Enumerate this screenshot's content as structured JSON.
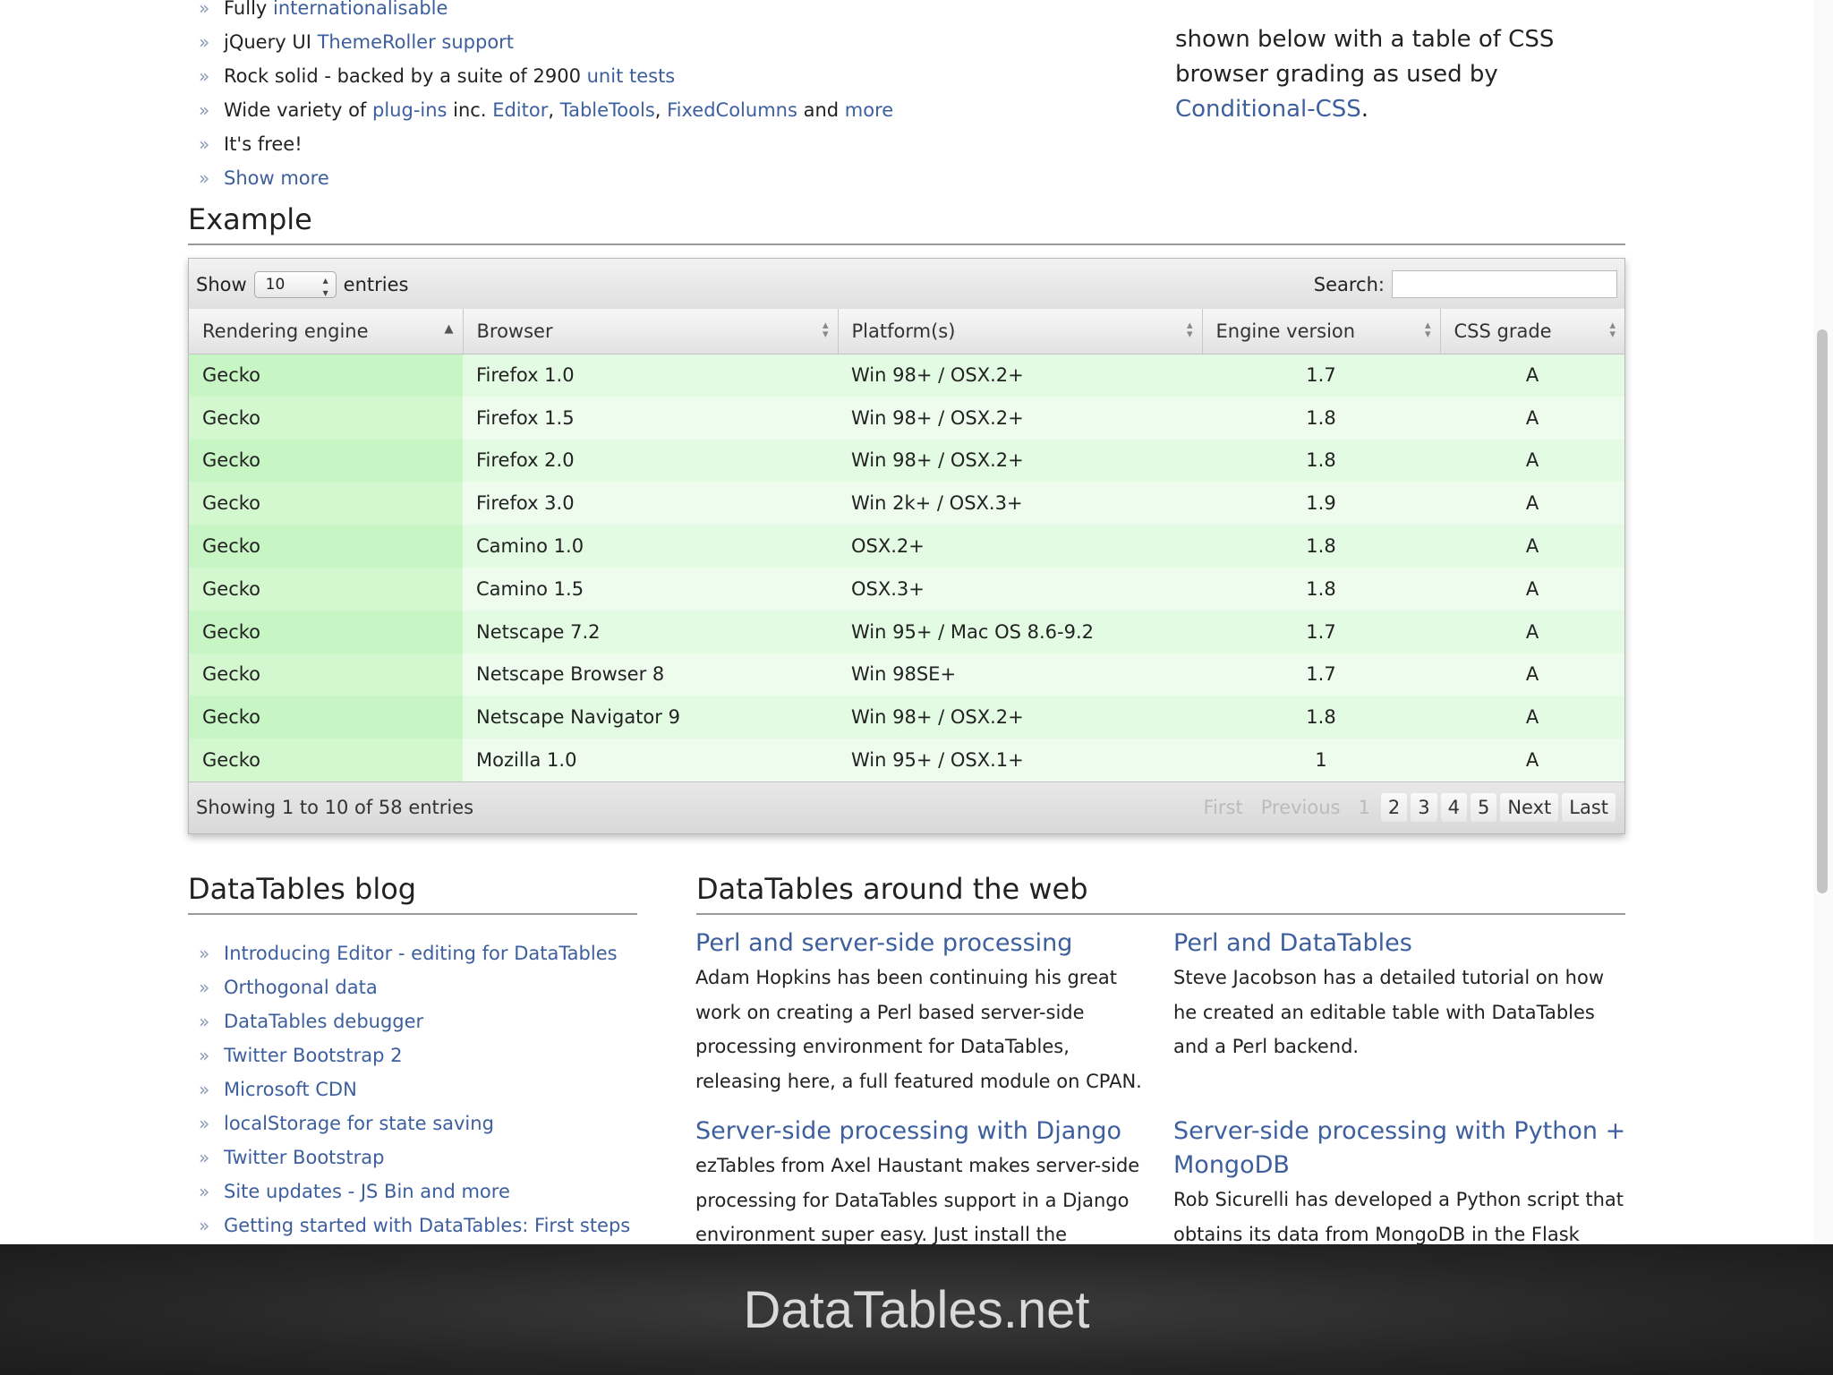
{
  "features": [
    {
      "prefix": "Fully ",
      "links": [
        "internationalisable"
      ],
      "rest": ""
    },
    {
      "prefix": "jQuery UI ",
      "links": [
        "ThemeRoller support"
      ],
      "rest": ""
    },
    {
      "prefix": "Rock solid - backed by a suite of 2900 ",
      "links": [
        "unit tests"
      ],
      "rest": ""
    },
    {
      "prefix": "Wide variety of ",
      "links": [
        "plug-ins"
      ],
      "rest": ""
    },
    {
      "prefix": "It's free!",
      "links": [],
      "rest": ""
    },
    {
      "prefix": "",
      "links": [
        "Show more"
      ],
      "rest": ""
    }
  ],
  "wide_variety": {
    "prefix": "Wide variety of ",
    "plugins": "plug-ins",
    "inc": " inc. ",
    "editor": "Editor",
    "sep1": ", ",
    "tabletools": "TableTools",
    "sep2": ", ",
    "fixedcolumns": "FixedColumns",
    "and": " and ",
    "more": "more"
  },
  "top_right": {
    "line1": "shown below with a table of CSS",
    "line2": "browser grading as used by",
    "link": "Conditional-CSS",
    "tail": "."
  },
  "example": {
    "heading": "Example",
    "show_label": "Show",
    "length_value": "10",
    "entries_label": "entries",
    "search_label": "Search:",
    "search_value": "",
    "columns": [
      "Rendering engine",
      "Browser",
      "Platform(s)",
      "Engine version",
      "CSS grade"
    ],
    "rows": [
      [
        "Gecko",
        "Firefox 1.0",
        "Win 98+ / OSX.2+",
        "1.7",
        "A"
      ],
      [
        "Gecko",
        "Firefox 1.5",
        "Win 98+ / OSX.2+",
        "1.8",
        "A"
      ],
      [
        "Gecko",
        "Firefox 2.0",
        "Win 98+ / OSX.2+",
        "1.8",
        "A"
      ],
      [
        "Gecko",
        "Firefox 3.0",
        "Win 2k+ / OSX.3+",
        "1.9",
        "A"
      ],
      [
        "Gecko",
        "Camino 1.0",
        "OSX.2+",
        "1.8",
        "A"
      ],
      [
        "Gecko",
        "Camino 1.5",
        "OSX.3+",
        "1.8",
        "A"
      ],
      [
        "Gecko",
        "Netscape 7.2",
        "Win 95+ / Mac OS 8.6-9.2",
        "1.7",
        "A"
      ],
      [
        "Gecko",
        "Netscape Browser 8",
        "Win 98SE+",
        "1.7",
        "A"
      ],
      [
        "Gecko",
        "Netscape Navigator 9",
        "Win 98+ / OSX.2+",
        "1.8",
        "A"
      ],
      [
        "Gecko",
        "Mozilla 1.0",
        "Win 95+ / OSX.1+",
        "1",
        "A"
      ]
    ],
    "info": "Showing 1 to 10 of 58 entries",
    "paging": {
      "first": "First",
      "previous": "Previous",
      "pages": [
        "1",
        "2",
        "3",
        "4",
        "5"
      ],
      "next": "Next",
      "last": "Last"
    }
  },
  "blog": {
    "heading": "DataTables blog",
    "items": [
      "Introducing Editor - editing for DataTables",
      "Orthogonal data",
      "DataTables debugger",
      "Twitter Bootstrap 2",
      "Microsoft CDN",
      "localStorage for state saving",
      "Twitter Bootstrap",
      "Site updates - JS Bin and more",
      "Getting started with DataTables: First steps"
    ]
  },
  "web": {
    "heading": "DataTables around the web",
    "items": [
      {
        "title": "Perl and server-side processing",
        "body": "Adam Hopkins has been continuing his great work on creating a Perl based server-side processing environment for DataTables, releasing here, a full featured module on CPAN."
      },
      {
        "title": "Perl and DataTables",
        "body": "Steve Jacobson has a detailed tutorial on how he created an editable table with DataTables and a Perl backend."
      },
      {
        "title": "Server-side processing with Django",
        "body": "ezTables from Axel Haustant makes server-side processing for DataTables support in a Django environment super easy. Just install the package"
      },
      {
        "title": "Server-side processing with Python + MongoDB",
        "body": "Rob Sicurelli has developed a Python script that obtains its data from MongoDB in the Flask"
      }
    ]
  },
  "caption": "DataTables.net"
}
